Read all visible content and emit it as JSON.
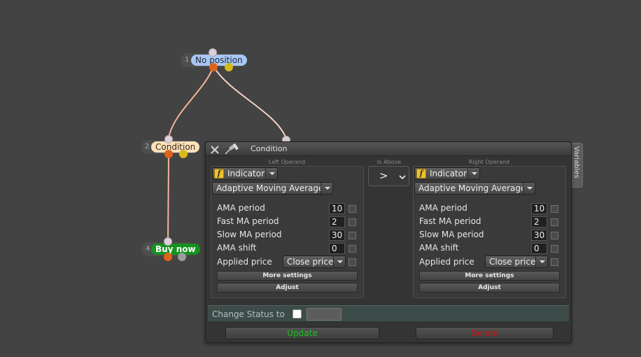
{
  "nodes": [
    {
      "number": "1",
      "label": "No position",
      "color": "#a9c7f3"
    },
    {
      "number": "2",
      "label": "Condition",
      "color": "#fde1bd"
    },
    {
      "number": "4",
      "label": "Buy now",
      "color": "#14941e"
    }
  ],
  "dialog": {
    "title": "Condition",
    "side_tab": "Variables",
    "left_operand_heading": "Left Operand",
    "operator_heading": "Is Above",
    "right_operand_heading": "Right Operand",
    "operator_symbol": ">",
    "left": {
      "source_type": "Indicator",
      "indicator": "Adaptive Moving Average",
      "params": [
        {
          "label": "AMA period",
          "value": "10",
          "checked": false
        },
        {
          "label": "Fast MA period",
          "value": "2",
          "checked": false
        },
        {
          "label": "Slow MA period",
          "value": "30",
          "checked": false
        },
        {
          "label": "AMA shift",
          "value": "0",
          "checked": false
        }
      ],
      "applied_price_label": "Applied price",
      "applied_price_value": "Close price",
      "more_settings": "More settings",
      "adjust": "Adjust"
    },
    "right": {
      "source_type": "Indicator",
      "indicator": "Adaptive Moving Average",
      "params": [
        {
          "label": "AMA period",
          "value": "10",
          "checked": false
        },
        {
          "label": "Fast MA period",
          "value": "2",
          "checked": false
        },
        {
          "label": "Slow MA period",
          "value": "30",
          "checked": false
        },
        {
          "label": "AMA shift",
          "value": "0",
          "checked": false
        }
      ],
      "applied_price_label": "Applied price",
      "applied_price_value": "Close price",
      "more_settings": "More settings",
      "adjust": "Adjust"
    },
    "change_status_label": "Change Status to",
    "change_status_checked": false,
    "update_label": "Update",
    "delete_label": "Delete",
    "colors": {
      "update_text": "#1fbf1f",
      "delete_text": "#c31414",
      "connector": "#e0621a"
    }
  }
}
